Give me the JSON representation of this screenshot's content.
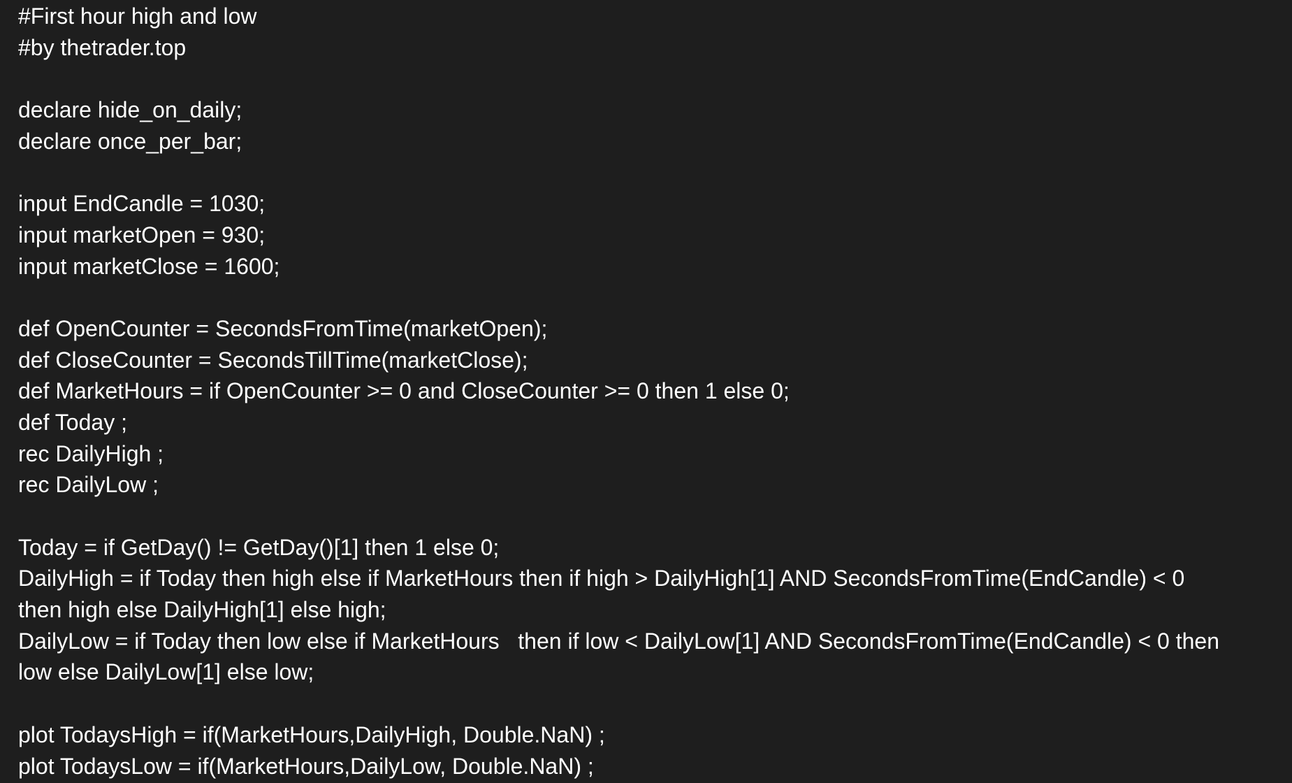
{
  "code": {
    "lines": [
      "#First hour high and low",
      "#by thetrader.top",
      "",
      "declare hide_on_daily;",
      "declare once_per_bar;",
      "",
      "input EndCandle = 1030;",
      "input marketOpen = 930;",
      "input marketClose = 1600;",
      "",
      "def OpenCounter = SecondsFromTime(marketOpen);",
      "def CloseCounter = SecondsTillTime(marketClose);",
      "def MarketHours = if OpenCounter >= 0 and CloseCounter >= 0 then 1 else 0;",
      "def Today ;",
      "rec DailyHigh ;",
      "rec DailyLow ;",
      "",
      "Today = if GetDay() != GetDay()[1] then 1 else 0;",
      "DailyHigh = if Today then high else if MarketHours then if high > DailyHigh[1] AND SecondsFromTime(EndCandle) < 0",
      "then high else DailyHigh[1] else high;",
      "DailyLow = if Today then low else if MarketHours   then if low < DailyLow[1] AND SecondsFromTime(EndCandle) < 0 then",
      "low else DailyLow[1] else low;",
      "",
      "plot TodaysHigh = if(MarketHours,DailyHigh, Double.NaN) ;",
      "plot TodaysLow = if(MarketHours,DailyLow, Double.NaN) ;"
    ]
  },
  "colors": {
    "background": "#1e1e1e",
    "text": "#ffffff"
  }
}
